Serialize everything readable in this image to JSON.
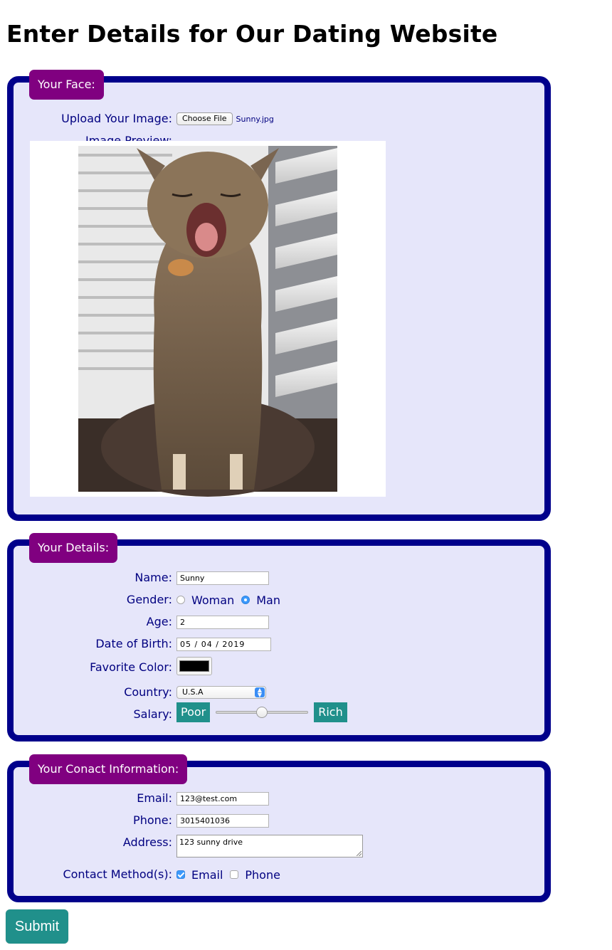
{
  "page": {
    "title": "Enter Details for Our Dating Website"
  },
  "face": {
    "legend": "Your Face:",
    "upload_label": "Upload Your Image:",
    "file_button": "Choose File",
    "file_name": "Sunny.jpg",
    "preview_label": "Image Preview:"
  },
  "details": {
    "legend": "Your Details:",
    "name_label": "Name:",
    "name_value": "Sunny",
    "gender_label": "Gender:",
    "gender_options": [
      "Woman",
      "Man"
    ],
    "gender_selected": "Man",
    "age_label": "Age:",
    "age_value": "2",
    "dob_label": "Date of Birth:",
    "dob_value": "05 / 04 / 2019",
    "color_label": "Favorite Color:",
    "color_value": "#000000",
    "country_label": "Country:",
    "country_value": "U.S.A",
    "salary_label": "Salary:",
    "salary_min_label": "Poor",
    "salary_max_label": "Rich",
    "salary_level": 0.5
  },
  "contact": {
    "legend": "Your Conact Information:",
    "email_label": "Email:",
    "email_value": "123@test.com",
    "phone_label": "Phone:",
    "phone_value": "3015401036",
    "address_label": "Address:",
    "address_value": "123 sunny drive",
    "method_label": "Contact Method(s):",
    "methods": [
      "Email",
      "Phone"
    ],
    "methods_checked": [
      "Email"
    ]
  },
  "submit_label": "Submit",
  "colors": {
    "panel_border": "#00008b",
    "panel_bg": "#e6e6fa",
    "legend_bg": "#800080",
    "accent_teal": "#20908b",
    "label_text": "#000080"
  }
}
